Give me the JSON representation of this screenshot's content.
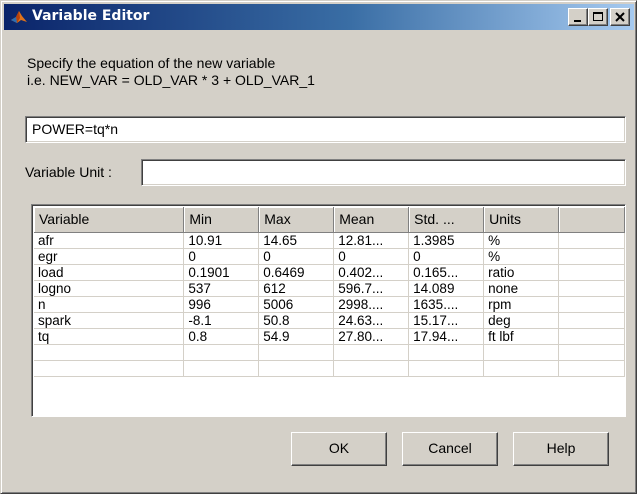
{
  "window": {
    "title": "Variable Editor"
  },
  "instructions": {
    "line1": "Specify the equation of the new variable",
    "line2": "i.e. NEW_VAR = OLD_VAR * 3 + OLD_VAR_1"
  },
  "equation": {
    "value": "POWER=tq*n"
  },
  "unit": {
    "label": "Variable Unit :",
    "value": ""
  },
  "table": {
    "headers": [
      "Variable",
      "Min",
      "Max",
      "Mean",
      "Std. ...",
      "Units",
      ""
    ],
    "rows": [
      [
        "afr",
        "10.91",
        "14.65",
        "12.81...",
        "1.3985",
        "%",
        ""
      ],
      [
        "egr",
        "0",
        "0",
        "0",
        "0",
        "%",
        ""
      ],
      [
        "load",
        "0.1901",
        "0.6469",
        "0.402...",
        "0.165...",
        "ratio",
        ""
      ],
      [
        "logno",
        "537",
        "612",
        "596.7...",
        "14.089",
        "none",
        ""
      ],
      [
        "n",
        "996",
        "5006",
        "2998....",
        "1635....",
        "rpm",
        ""
      ],
      [
        "spark",
        "-8.1",
        "50.8",
        "24.63...",
        "15.17...",
        "deg",
        ""
      ],
      [
        "tq",
        "0.8",
        "54.9",
        "27.80...",
        "17.94...",
        "ft lbf",
        ""
      ],
      [
        "",
        "",
        "",
        "",
        "",
        "",
        ""
      ],
      [
        "",
        "",
        "",
        "",
        "",
        "",
        ""
      ]
    ]
  },
  "buttons": {
    "ok": "OK",
    "cancel": "Cancel",
    "help": "Help"
  },
  "icons": {
    "app": "matlab-logo-icon",
    "minimize": "minimize-icon",
    "maximize": "maximize-icon",
    "close": "close-icon"
  },
  "colors": {
    "titlebar_start": "#0a246a",
    "titlebar_end": "#a6caf0",
    "face": "#d4d0c8"
  }
}
